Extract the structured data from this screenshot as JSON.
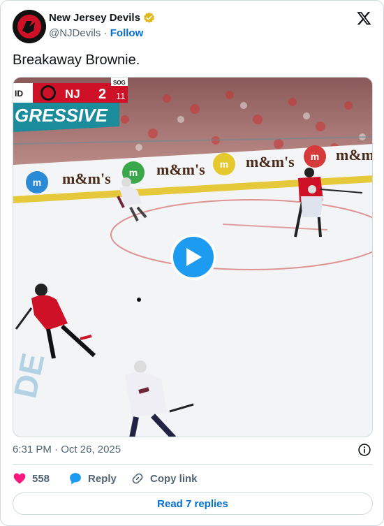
{
  "author": {
    "display_name": "New Jersey Devils",
    "handle": "@NJDevils",
    "separator": "·",
    "follow_label": "Follow",
    "verified": true
  },
  "tweet": {
    "text": "Breakaway Brownie."
  },
  "media": {
    "scorebug": {
      "period": "ID",
      "team": "NJ",
      "score": "2",
      "sog_label": "SOG",
      "sog_value": "11"
    },
    "banner_text": "GRESSIVE",
    "board_ads": [
      "m",
      "m&m's",
      "m",
      "m&m's",
      "m",
      "m&m's",
      "m",
      "m&m's"
    ],
    "ice_text": "DE"
  },
  "meta": {
    "time": "6:31 PM",
    "separator": "·",
    "date": "Oct 26, 2025"
  },
  "actions": {
    "likes": "558",
    "reply_label": "Reply",
    "copy_label": "Copy link"
  },
  "read_replies_label": "Read 7 replies",
  "colors": {
    "like": "#f91880",
    "reply": "#1d9bf0",
    "link": "#006fd6",
    "play": "#1d9bf0",
    "verified": "#e2b719",
    "devils_red": "#ce1126"
  }
}
